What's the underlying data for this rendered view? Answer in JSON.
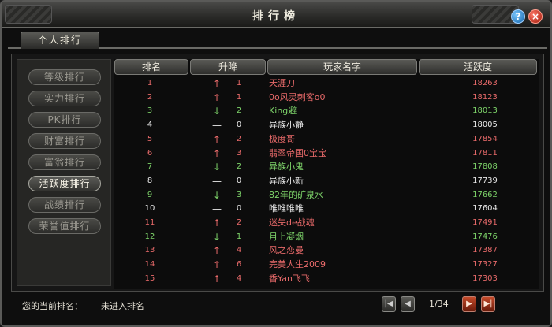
{
  "window": {
    "title": "排行榜"
  },
  "tabs": [
    {
      "label": "个人排行"
    }
  ],
  "sidebar": {
    "items": [
      {
        "label": "等级排行",
        "active": false
      },
      {
        "label": "实力排行",
        "active": false
      },
      {
        "label": "PK排行",
        "active": false
      },
      {
        "label": "财富排行",
        "active": false
      },
      {
        "label": "富翁排行",
        "active": false
      },
      {
        "label": "活跃度排行",
        "active": true
      },
      {
        "label": "战绩排行",
        "active": false
      },
      {
        "label": "荣誉值排行",
        "active": false
      }
    ]
  },
  "table": {
    "headers": {
      "rank": "排名",
      "move": "升降",
      "name": "玩家名字",
      "score": "活跃度"
    },
    "rows": [
      {
        "rank": "1",
        "dir": "up",
        "arrow": "↑",
        "move": "1",
        "name": "天涯刀",
        "score": "18263",
        "color": "#e86a6a"
      },
      {
        "rank": "2",
        "dir": "up",
        "arrow": "↑",
        "move": "1",
        "name": "0o风灵刺客o0",
        "score": "18123",
        "color": "#e86a6a"
      },
      {
        "rank": "3",
        "dir": "down",
        "arrow": "↓",
        "move": "2",
        "name": "King避",
        "score": "18013",
        "color": "#7ed46a"
      },
      {
        "rank": "4",
        "dir": "same",
        "arrow": "—",
        "move": "0",
        "name": "异族小静",
        "score": "18005",
        "color": "#e8e8e8"
      },
      {
        "rank": "5",
        "dir": "up",
        "arrow": "↑",
        "move": "2",
        "name": "极度哥",
        "score": "17854",
        "color": "#e86a6a"
      },
      {
        "rank": "6",
        "dir": "up",
        "arrow": "↑",
        "move": "3",
        "name": "翡翠帝国0宝宝",
        "score": "17811",
        "color": "#e86a6a"
      },
      {
        "rank": "7",
        "dir": "down",
        "arrow": "↓",
        "move": "2",
        "name": "异族小鬼",
        "score": "17808",
        "color": "#7ed46a"
      },
      {
        "rank": "8",
        "dir": "same",
        "arrow": "—",
        "move": "0",
        "name": "异族小新",
        "score": "17739",
        "color": "#e8e8e8"
      },
      {
        "rank": "9",
        "dir": "down",
        "arrow": "↓",
        "move": "3",
        "name": "82年的矿泉水",
        "score": "17662",
        "color": "#7ed46a"
      },
      {
        "rank": "10",
        "dir": "same",
        "arrow": "—",
        "move": "0",
        "name": "唯唯唯唯",
        "score": "17604",
        "color": "#e8e8e8"
      },
      {
        "rank": "11",
        "dir": "up",
        "arrow": "↑",
        "move": "2",
        "name": "迷失de战魂",
        "score": "17491",
        "color": "#e86a6a"
      },
      {
        "rank": "12",
        "dir": "down",
        "arrow": "↓",
        "move": "1",
        "name": "月上凝烟",
        "score": "17476",
        "color": "#7ed46a"
      },
      {
        "rank": "13",
        "dir": "up",
        "arrow": "↑",
        "move": "4",
        "name": "风之恋曼",
        "score": "17387",
        "color": "#e86a6a"
      },
      {
        "rank": "14",
        "dir": "up",
        "arrow": "↑",
        "move": "6",
        "name": "完美人生2009",
        "score": "17327",
        "color": "#e86a6a"
      },
      {
        "rank": "15",
        "dir": "up",
        "arrow": "↑",
        "move": "4",
        "name": "香Yan飞飞",
        "score": "17303",
        "color": "#e86a6a"
      }
    ]
  },
  "footer": {
    "current_rank_label": "您的当前排名：",
    "current_rank_value": "未进入排名",
    "pagination": {
      "page_text": "1/34",
      "first_icon": "first-page-icon",
      "prev_icon": "prev-page-icon",
      "next_icon": "next-page-icon",
      "last_icon": "last-page-icon"
    }
  }
}
